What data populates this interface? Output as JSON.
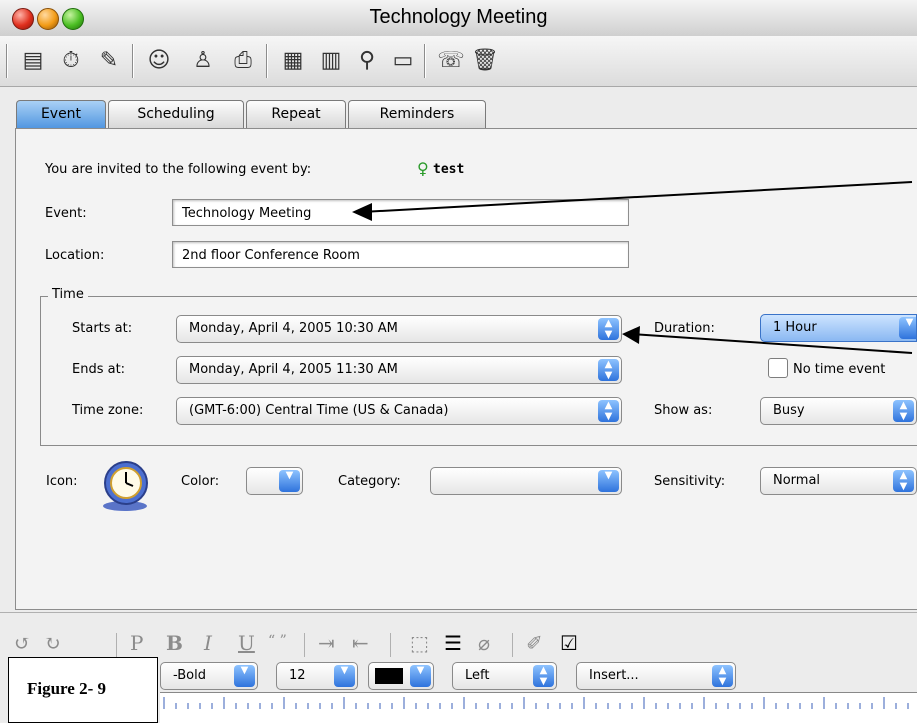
{
  "window": {
    "title": "Technology Meeting"
  },
  "tabs": [
    "Event",
    "Scheduling",
    "Repeat",
    "Reminders"
  ],
  "event_panel": {
    "invite_text": "You are invited to the following event by:",
    "organizer": "test",
    "event_label": "Event:",
    "event_value": "Technology Meeting",
    "location_label": "Location:",
    "location_value": "2nd floor Conference Room",
    "time_group_label": "Time",
    "starts_label": "Starts at:",
    "starts_value": "Monday, April 4, 2005 10:30 AM",
    "ends_label": "Ends at:",
    "ends_value": "Monday, April 4, 2005 11:30 AM",
    "timezone_label": "Time zone:",
    "timezone_value": "(GMT-6:00) Central Time (US & Canada)",
    "duration_label": "Duration:",
    "duration_value": "1 Hour",
    "no_time_label": "No time event",
    "show_as_label": "Show as:",
    "show_as_value": "Busy",
    "icon_label": "Icon:",
    "color_label": "Color:",
    "category_label": "Category:",
    "category_value": "",
    "sensitivity_label": "Sensitivity:",
    "sensitivity_value": "Normal"
  },
  "format_bar": {
    "font_value": "-Bold",
    "size_value": "12",
    "align_value": "Left",
    "insert_value": "Insert..."
  },
  "caption": "Figure 2- 9",
  "icons": {
    "toolbar": [
      "new-note-icon",
      "alarm-icon",
      "edit-icon",
      "send-icon",
      "attendee-icon",
      "print-icon",
      "calendar-icon",
      "print2-icon",
      "search-icon",
      "folder-icon",
      "phone-icon",
      "trash-icon"
    ]
  }
}
